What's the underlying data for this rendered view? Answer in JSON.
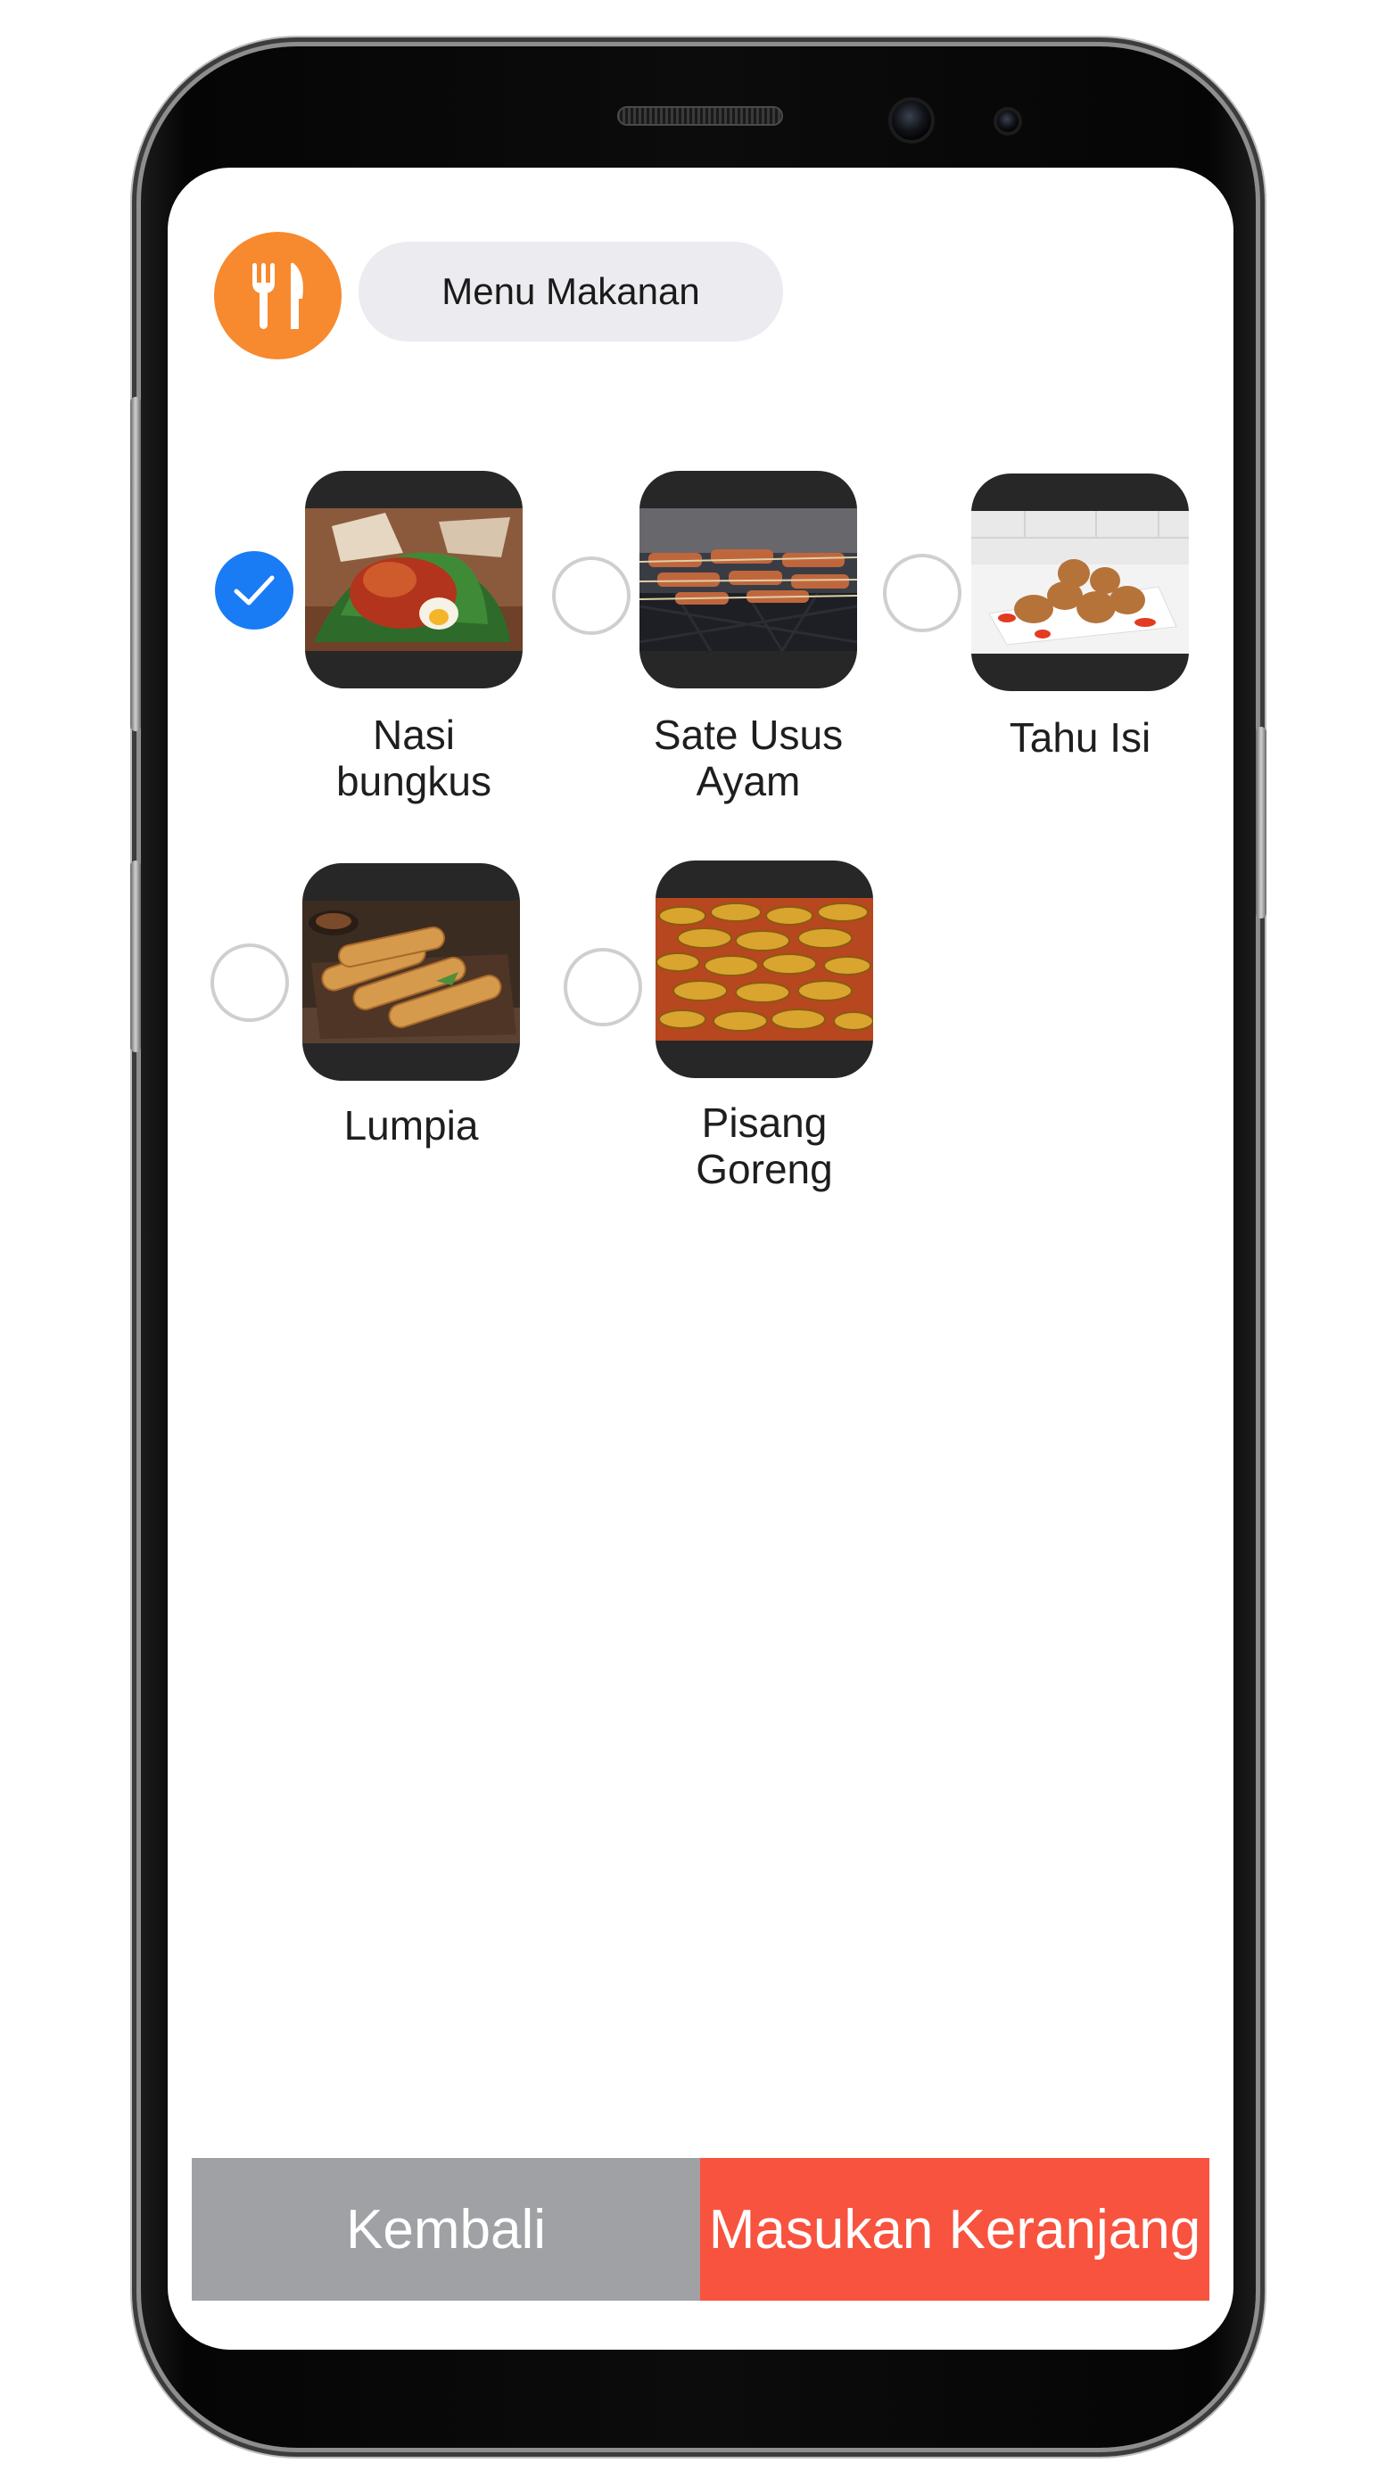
{
  "header": {
    "icon": "fork-knife-icon",
    "title": "Menu Makanan",
    "accent_color": "#f7892f"
  },
  "menu": {
    "items": [
      {
        "label": "Nasi bungkus",
        "label_lines": [
          "Nasi",
          "bungkus"
        ],
        "selected": true
      },
      {
        "label": "Sate Usus Ayam",
        "label_lines": [
          "Sate Usus",
          "Ayam"
        ],
        "selected": false
      },
      {
        "label": "Tahu Isi",
        "label_lines": [
          "Tahu Isi"
        ],
        "selected": false
      },
      {
        "label": "Lumpia",
        "label_lines": [
          "Lumpia"
        ],
        "selected": false
      },
      {
        "label": "Pisang Goreng",
        "label_lines": [
          "Pisang",
          "Goreng"
        ],
        "selected": false
      }
    ],
    "selected_color": "#1a7cf5"
  },
  "footer": {
    "back_label": "Kembali",
    "cart_label": "Masukan Keranjang",
    "back_color": "#a0a1a5",
    "cart_color": "#f8533f"
  }
}
